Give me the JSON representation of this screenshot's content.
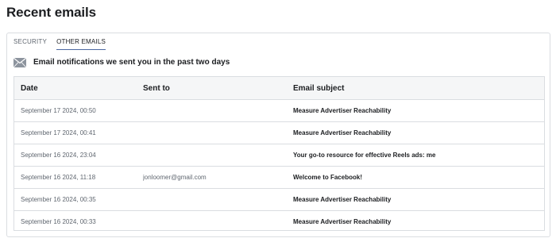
{
  "page": {
    "title": "Recent emails"
  },
  "tabs": [
    {
      "label": "SECURITY",
      "active": false
    },
    {
      "label": "OTHER EMAILS",
      "active": true
    }
  ],
  "section": {
    "icon": "envelope-icon",
    "title": "Email notifications we sent you in the past two days"
  },
  "table": {
    "columns": [
      "Date",
      "Sent to",
      "Email subject"
    ],
    "rows": [
      {
        "date": "September 17 2024, 00:50",
        "sent_to": "",
        "subject": "Measure Advertiser Reachability"
      },
      {
        "date": "September 17 2024, 00:41",
        "sent_to": "",
        "subject": "Measure Advertiser Reachability"
      },
      {
        "date": "September 16 2024, 23:04",
        "sent_to": "",
        "subject": "Your go-to resource for effective Reels ads: me"
      },
      {
        "date": "September 16 2024, 11:18",
        "sent_to": "jonloomer@gmail.com",
        "subject": "Welcome to Facebook!"
      },
      {
        "date": "September 16 2024, 00:35",
        "sent_to": "",
        "subject": "Measure Advertiser Reachability"
      },
      {
        "date": "September 16 2024, 00:33",
        "sent_to": "",
        "subject": "Measure Advertiser Reachability"
      }
    ]
  },
  "colors": {
    "active_tab_underline": "#4b67a1",
    "header_background": "#f5f6f7",
    "border": "#dadde1",
    "muted_text": "#606770"
  }
}
